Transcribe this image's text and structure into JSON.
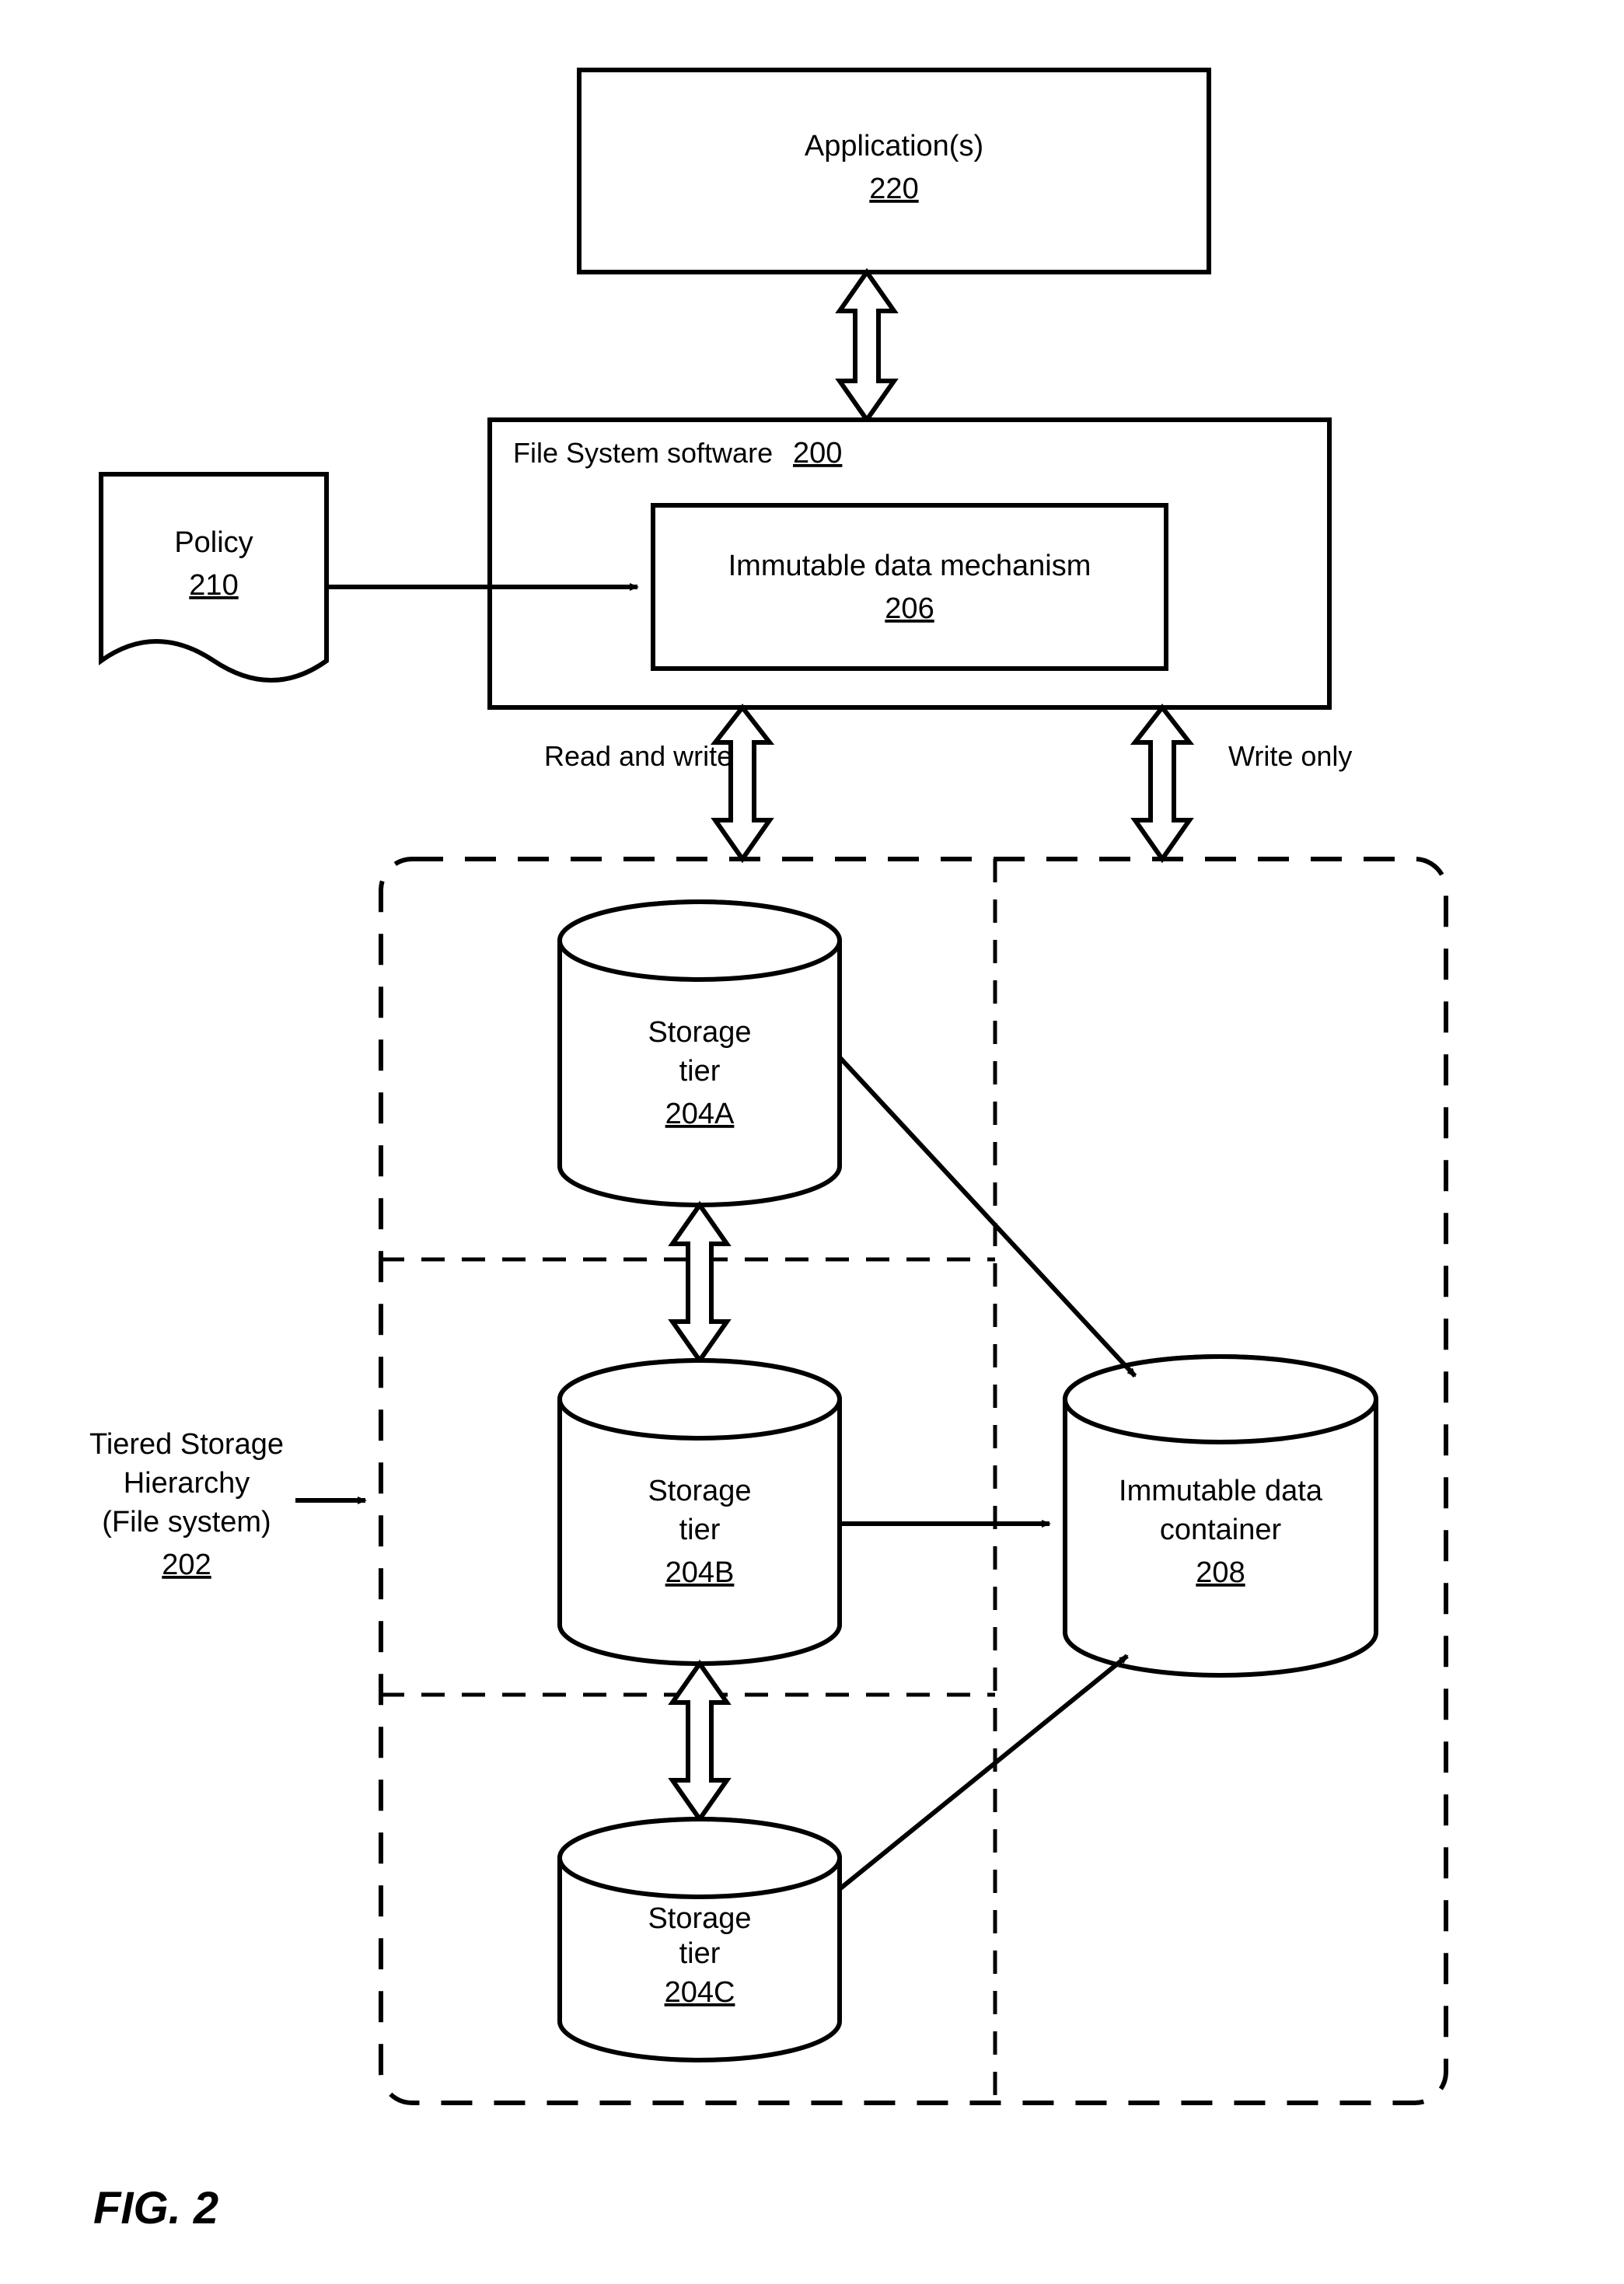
{
  "figure_label": "FIG. 2",
  "applications": {
    "label": "Application(s)",
    "ref": "220"
  },
  "file_system": {
    "title_prefix": "File System software",
    "ref": "200",
    "immutable_mechanism": {
      "label": "Immutable data mechanism",
      "ref": "206"
    }
  },
  "policy": {
    "label": "Policy",
    "ref": "210"
  },
  "arrow_labels": {
    "read_write": "Read and write",
    "write_only": "Write only"
  },
  "storage_hierarchy": {
    "label_line1": "Tiered Storage",
    "label_line2": "Hierarchy",
    "label_line3": "(File system)",
    "ref": "202",
    "tiers": [
      {
        "label1": "Storage",
        "label2": "tier",
        "ref": "204A"
      },
      {
        "label1": "Storage",
        "label2": "tier",
        "ref": "204B"
      },
      {
        "label1": "Storage",
        "label2": "tier",
        "ref": "204C"
      }
    ],
    "immutable_container": {
      "label1": "Immutable data",
      "label2": "container",
      "ref": "208"
    }
  }
}
